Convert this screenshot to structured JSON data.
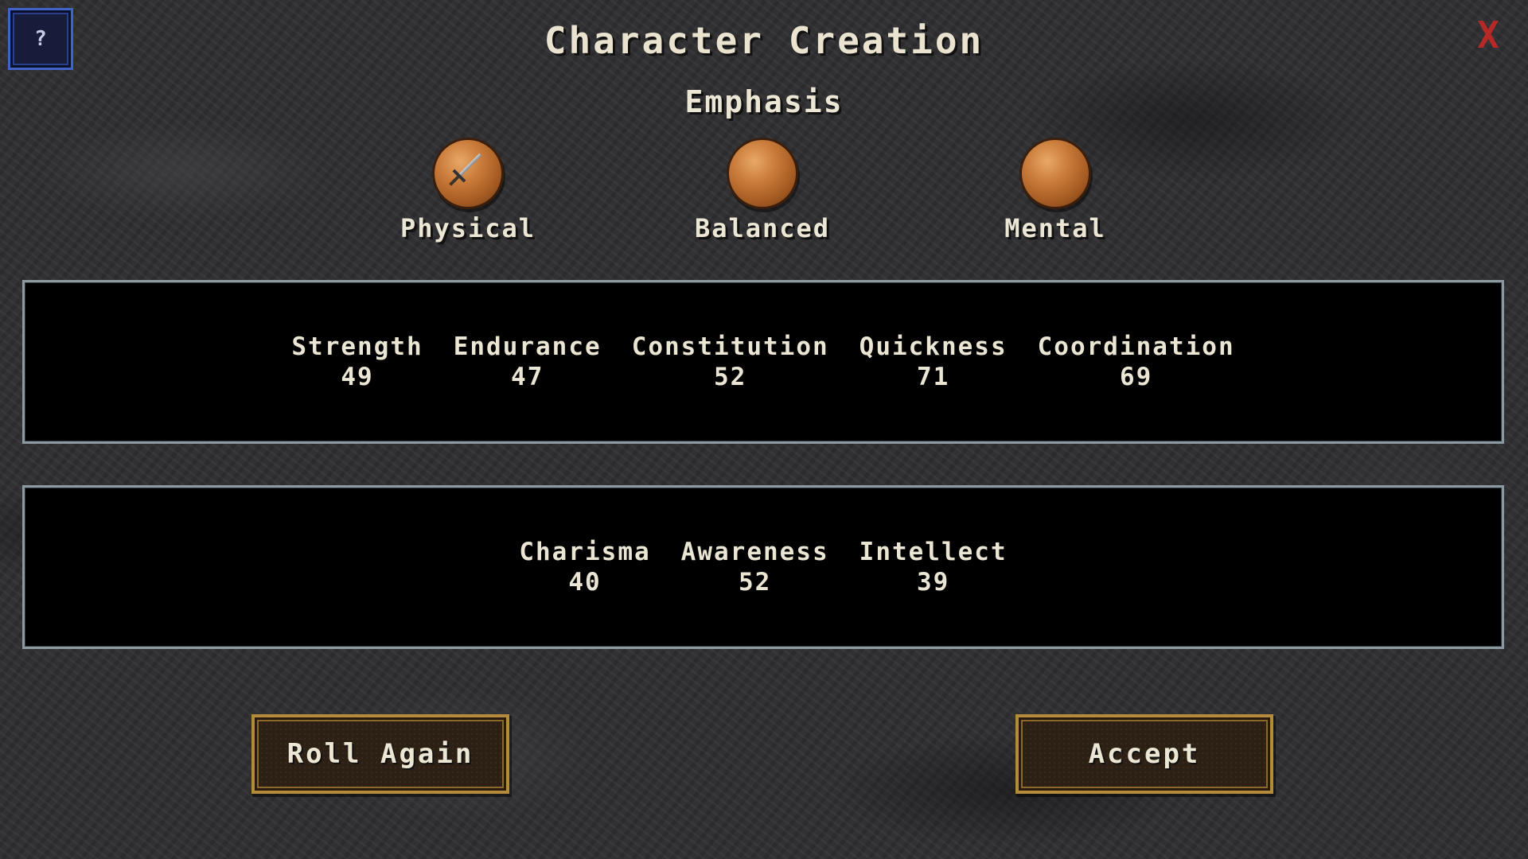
{
  "header": {
    "help_label": "?",
    "close_label": "X",
    "title": "Character Creation"
  },
  "emphasis": {
    "title": "Emphasis",
    "options": [
      {
        "label": "Physical",
        "icon": "sword-orb-icon",
        "selected": true
      },
      {
        "label": "Balanced",
        "icon": "orb-icon",
        "selected": false
      },
      {
        "label": "Mental",
        "icon": "orb-icon",
        "selected": false
      }
    ]
  },
  "physical_stats": [
    {
      "name": "Strength",
      "value": "49"
    },
    {
      "name": "Endurance",
      "value": "47"
    },
    {
      "name": "Constitution",
      "value": "52"
    },
    {
      "name": "Quickness",
      "value": "71"
    },
    {
      "name": "Coordination",
      "value": "69"
    }
  ],
  "mental_stats": [
    {
      "name": "Charisma",
      "value": "40"
    },
    {
      "name": "Awareness",
      "value": "52"
    },
    {
      "name": "Intellect",
      "value": "39"
    }
  ],
  "buttons": {
    "roll_again": "Roll Again",
    "accept": "Accept"
  },
  "colors": {
    "close": "#b52a26",
    "help_border": "#3f63c9",
    "button_border": "#b48a3c",
    "orb": "#c97b3a"
  }
}
